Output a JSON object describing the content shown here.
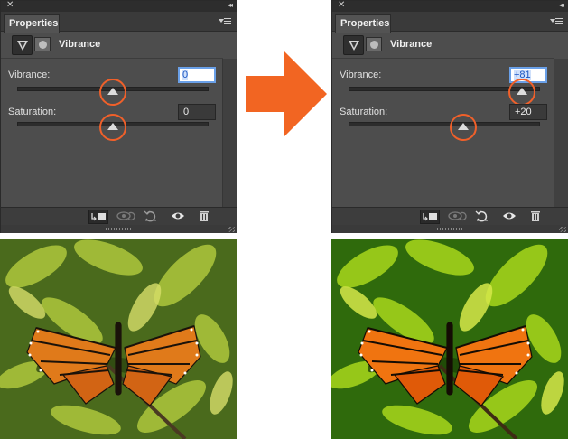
{
  "before": {
    "tab_label": "Properties",
    "adjustment_title": "Vibrance",
    "vibrance_label": "Vibrance:",
    "vibrance_value": "0",
    "saturation_label": "Saturation:",
    "saturation_value": "0",
    "vibrance_level": 0,
    "saturation_level": 0
  },
  "after": {
    "tab_label": "Properties",
    "adjustment_title": "Vibrance",
    "vibrance_label": "Vibrance:",
    "vibrance_value": "+81",
    "saturation_label": "Saturation:",
    "saturation_value": "+20",
    "vibrance_level": 81,
    "saturation_level": 20
  },
  "colors": {
    "panel_bg": "#4d4d4d",
    "highlight_ring": "#f0602a",
    "arrow": "#f26522",
    "focus_border": "#6aa0e8"
  },
  "icons": {
    "close": "close-icon",
    "collapse": "collapse-icon",
    "panel_menu": "panel-menu-icon",
    "adjustment": "vibrance-adjustment-icon",
    "mask": "layer-mask-icon",
    "clip": "clip-to-layer-icon",
    "view_previous": "view-previous-state-icon",
    "reset": "reset-icon",
    "visibility": "eye-icon",
    "delete": "trash-icon"
  }
}
